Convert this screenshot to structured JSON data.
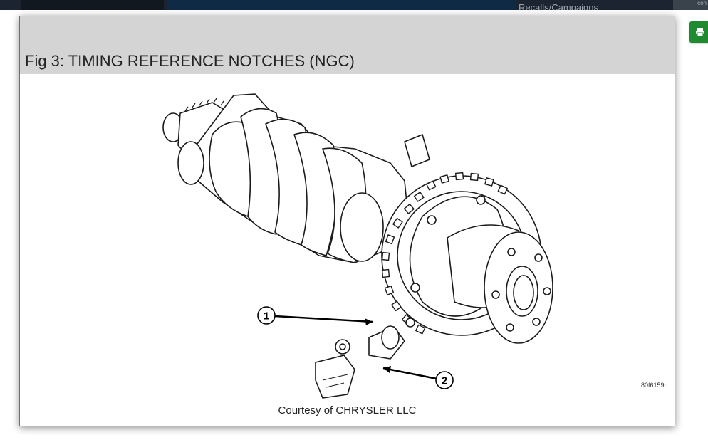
{
  "header": {
    "behind_text": "Recalls/Campaigns",
    "corner_text": "con"
  },
  "modal": {
    "title": "Fig 3: TIMING REFERENCE NOTCHES (NGC)",
    "figure_id": "80f6159d",
    "caption": "Courtesy of CHRYSLER LLC",
    "callouts": [
      {
        "number": "1",
        "target": "timing-reference-notches"
      },
      {
        "number": "2",
        "target": "crankshaft-position-sensor"
      }
    ]
  },
  "icons": {
    "print": "print-icon"
  },
  "colors": {
    "header_bg": "#d4d4d4",
    "print_button": "#1f8a2f",
    "top_bar": "#1b2430"
  }
}
